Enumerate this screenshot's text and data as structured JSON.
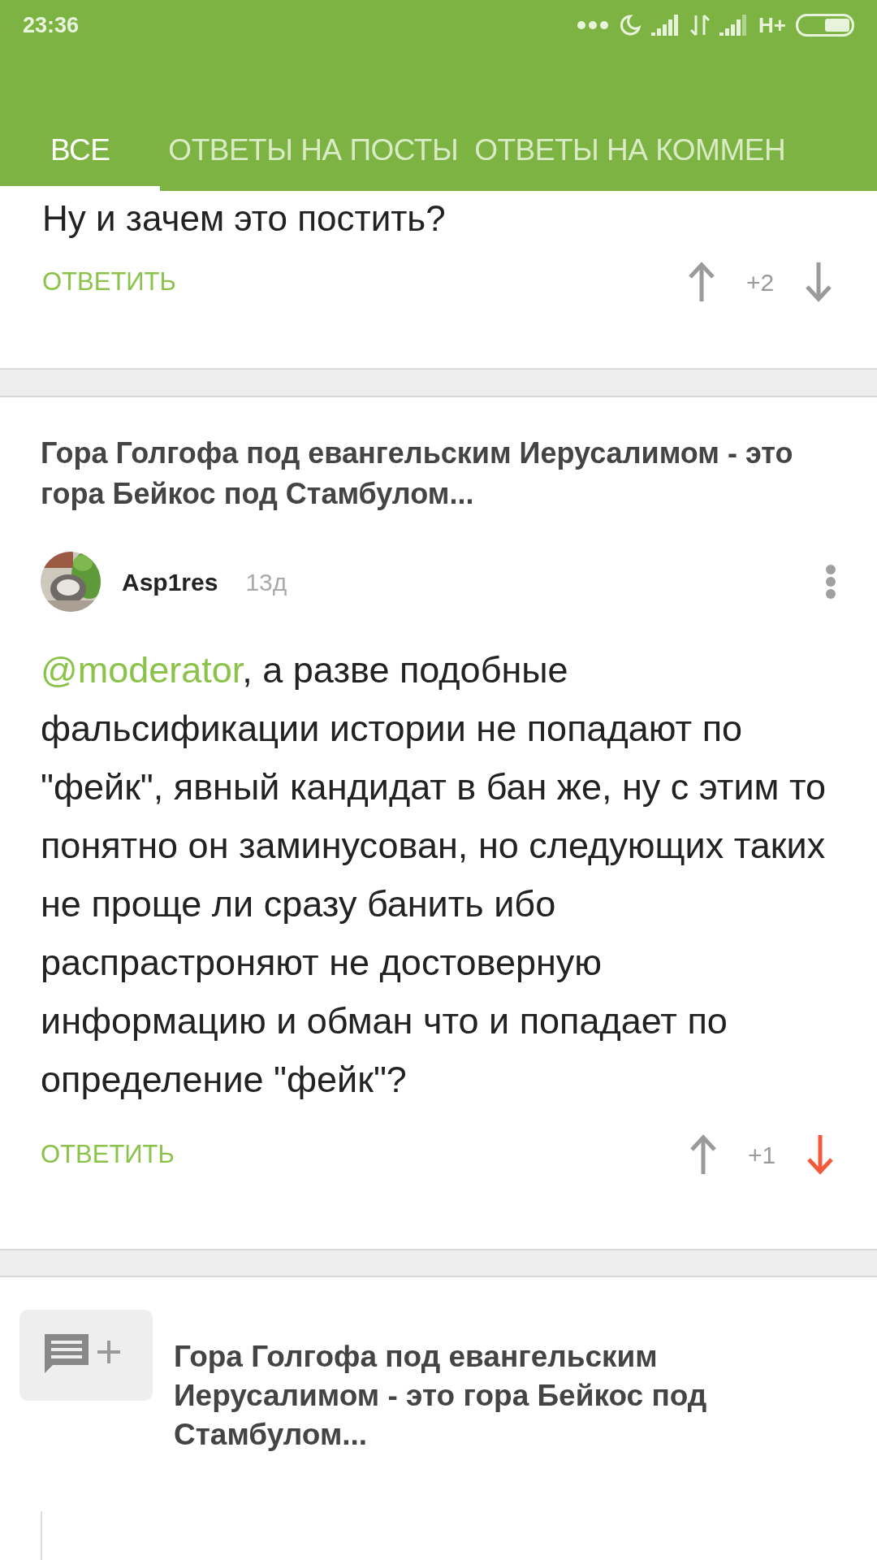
{
  "status_bar": {
    "time": "23:36",
    "network": "H+"
  },
  "tabs": [
    {
      "label": "ВСЕ",
      "selected": true
    },
    {
      "label": "ОТВЕТЫ НА ПОСТЫ",
      "selected": false
    },
    {
      "label": "ОТВЕТЫ НА КОММЕН",
      "selected": false
    }
  ],
  "comments": [
    {
      "text": "Ну и зачем это постить?",
      "reply": "ОТВЕТИТЬ",
      "score": "+2",
      "upvoted": false,
      "downvoted": false
    },
    {
      "post_title": "Гора Голгофа под евангельским Иерусалимом - это гора Бейкос под Стамбулом...",
      "author": "Asp1res",
      "age": "13д",
      "mention": "@moderator",
      "text": ",  а разве подобные фальсификации истории не попадают по \"фейк\", явный кандидат в бан же, ну с этим то понятно он заминусован, но следующих таких не проще ли сразу банить ибо распрастроняют не достоверную информацию и обман что и попадает по определение \"фейк\"?",
      "reply": "ОТВЕТИТЬ",
      "score": "+1",
      "upvoted": false,
      "downvoted": true
    }
  ],
  "post_card": {
    "title": "Гора Голгофа под евангельским Иерусалимом - это гора Бейкос под Стамбулом..."
  }
}
